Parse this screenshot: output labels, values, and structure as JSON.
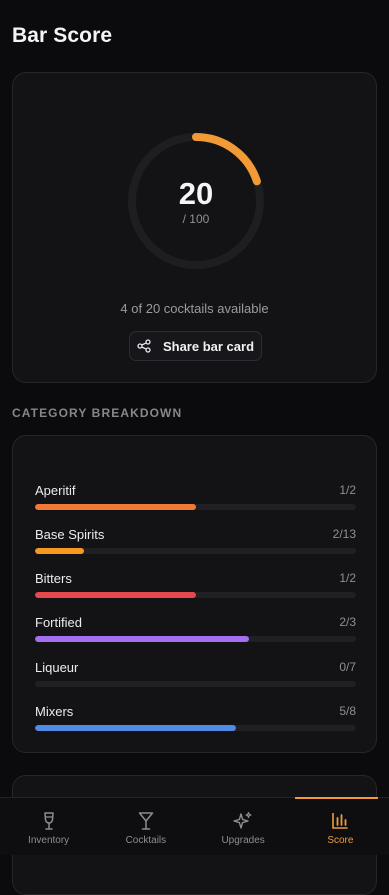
{
  "page": {
    "title": "Bar Score"
  },
  "score": {
    "value": "20",
    "max_label": "/ 100",
    "progress_fraction": 0.2,
    "accent_color": "#f29a36",
    "availability": "4 of 20 cocktails available",
    "share_label": "Share bar card"
  },
  "breakdown": {
    "heading": "CATEGORY BREAKDOWN",
    "categories": [
      {
        "name": "Aperitif",
        "count": "1/2",
        "fraction": 0.5,
        "color": "#f07a35"
      },
      {
        "name": "Base Spirits",
        "count": "2/13",
        "fraction": 0.154,
        "color": "#f59a1f"
      },
      {
        "name": "Bitters",
        "count": "1/2",
        "fraction": 0.5,
        "color": "#e5484d"
      },
      {
        "name": "Fortified",
        "count": "2/3",
        "fraction": 0.667,
        "color": "#a46ff0"
      },
      {
        "name": "Liqueur",
        "count": "0/7",
        "fraction": 0.0,
        "color": "#f29a36"
      },
      {
        "name": "Mixers",
        "count": "5/8",
        "fraction": 0.625,
        "color": "#4f8ae6"
      }
    ]
  },
  "tabs": [
    {
      "label": "Inventory",
      "icon": "wine-glass-icon",
      "active": false
    },
    {
      "label": "Cocktails",
      "icon": "cocktail-glass-icon",
      "active": false
    },
    {
      "label": "Upgrades",
      "icon": "sparkles-icon",
      "active": false
    },
    {
      "label": "Score",
      "icon": "bar-chart-icon",
      "active": true
    }
  ]
}
